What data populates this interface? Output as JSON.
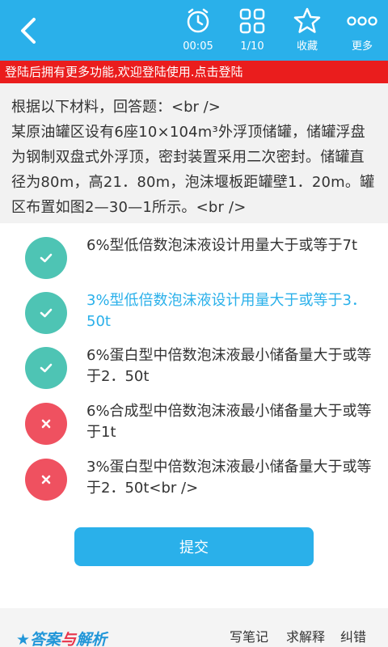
{
  "header": {
    "timer": {
      "label": "00:05",
      "icon": "alarm-clock-icon"
    },
    "progress": {
      "label": "1/10",
      "icon": "grid-icon"
    },
    "favorite": {
      "label": "收藏",
      "icon": "star-icon"
    },
    "more": {
      "label": "更多",
      "icon": "more-dots-icon"
    },
    "bar_color": "#2ab0ea"
  },
  "notice": {
    "text": "登陆后拥有更多功能,欢迎登陆使用.点击登陆",
    "color": "#ea1d1d"
  },
  "material": {
    "intro": "根据以下材料，回答题：<br />",
    "body": "某原油罐区设有6座10×104m³外浮顶储罐，储罐浮盘为钢制双盘式外浮顶，密封装置采用二次密封。储罐直径为80m，高21．80m，泡沫堰板距罐壁1．20m。罐区布置如图2—30—1所示。<br />"
  },
  "options": [
    {
      "text": "6%型低倍数泡沫液设计用量大于或等于7t",
      "status": "correct",
      "selected": false
    },
    {
      "text": "3%型低倍数泡沫液设计用量大于或等于3．50t",
      "status": "correct",
      "selected": true
    },
    {
      "text": "6%蛋白型中倍数泡沫液最小储备量大于或等于2．50t",
      "status": "correct",
      "selected": false
    },
    {
      "text": "6%合成型中倍数泡沫液最小储备量大于或等于1t",
      "status": "wrong",
      "selected": false
    },
    {
      "text": "3%蛋白型中倍数泡沫液最小储备量大于或等于2．50t<br />",
      "status": "wrong",
      "selected": false
    }
  ],
  "submit_label": "提交",
  "footer": {
    "logo_a": "★答案",
    "logo_b": "与",
    "logo_c": "解析",
    "links": [
      "写笔记",
      "求解释",
      "纠错"
    ]
  },
  "colors": {
    "correct": "#4ec4b4",
    "wrong": "#ef5160",
    "accent": "#2ab0ea"
  }
}
